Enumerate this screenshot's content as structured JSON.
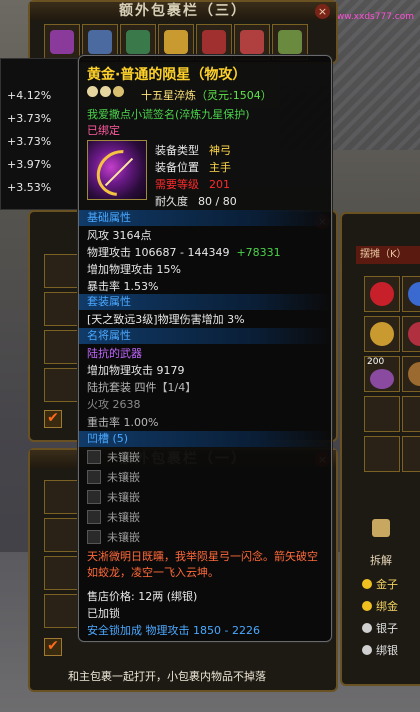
{
  "watermark": "小编专家 www.xxds777.com",
  "top_bag": {
    "title": "额外包裹栏（三）",
    "close": "×"
  },
  "left_stats": [
    "+4.12%",
    "+3.73%",
    "+3.73%",
    "+3.97%",
    "+3.53%"
  ],
  "mid_bag": {
    "close": "×"
  },
  "low_bag": {
    "title": "额外包裹栏（一）",
    "close": "×"
  },
  "checkbox_mark": "✔",
  "hint": "和主包裹一起打开，小包裹内物品不掉落",
  "stall": {
    "label": "摆摊（K）",
    "split": "拆解",
    "stack_count": "200",
    "coins": [
      {
        "label": "金子",
        "color": "#f0c020"
      },
      {
        "label": "绑金",
        "color": "#f0c020"
      },
      {
        "label": "银子",
        "color": "#d0d0d0"
      },
      {
        "label": "绑银",
        "color": "#d0d0d0"
      }
    ]
  },
  "tooltip": {
    "title": "黄金·普通的陨星（物攻）",
    "refine": "十五星淬炼",
    "refine_extra": "（灵元:1504）",
    "engrave": "我爱撒点小谎签名(淬炼九星保护)",
    "bound": "已绑定",
    "equip_type_label": "装备类型",
    "equip_type_value": "神弓",
    "equip_pos_label": "装备位置",
    "equip_pos_value": "主手",
    "level_label": "需要等级",
    "level_value": "201",
    "durability_label": "耐久度",
    "durability_value": "80 / 80",
    "basic_header": "基础属性",
    "wind_attack": "风攻 3164点",
    "phys_attack": "物理攻击 106687 - 144349",
    "phys_attack_plus": "+78331",
    "add_phys": "增加物理攻击 15%",
    "crit": "暴击率  1.53%",
    "set_header": "套装属性",
    "set_line": "[天之致远3级]物理伤害增加 3%",
    "name_header": "名将属性",
    "name_line": "陆抗的武器",
    "add_phys2": "增加物理攻击 9179",
    "set_name": "陆抗套装  四件【1/4】",
    "fire_attack": "火攻 2638",
    "heavy_hit": "重击率 1.00%",
    "socket_header": "凹槽 (5)",
    "sockets": [
      "未镶嵌",
      "未镶嵌",
      "未镶嵌",
      "未镶嵌",
      "未镶嵌"
    ],
    "quote": "天淅微明日既曛，我举陨星弓一闪念。箭矢破空如蛟龙，凌空一飞入云坤。",
    "price": "售店价格: 12两 (绑银)",
    "locked": "已加锁",
    "safe_lock": "安全锁加成   物理攻击  1850 - 2226"
  }
}
